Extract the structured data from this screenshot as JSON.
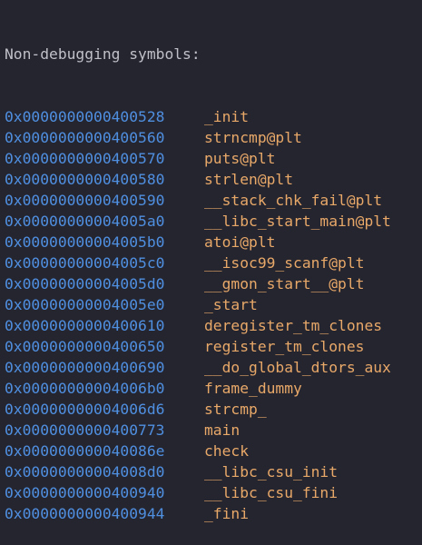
{
  "colors": {
    "background": "#252530",
    "header": "#c0c0c8",
    "address": "#4f8fe0",
    "symbol": "#e8a868"
  },
  "header": "Non-debugging symbols:",
  "symbols": [
    {
      "address": "0x0000000000400528",
      "name": "_init"
    },
    {
      "address": "0x0000000000400560",
      "name": "strncmp@plt"
    },
    {
      "address": "0x0000000000400570",
      "name": "puts@plt"
    },
    {
      "address": "0x0000000000400580",
      "name": "strlen@plt"
    },
    {
      "address": "0x0000000000400590",
      "name": "__stack_chk_fail@plt"
    },
    {
      "address": "0x00000000004005a0",
      "name": "__libc_start_main@plt"
    },
    {
      "address": "0x00000000004005b0",
      "name": "atoi@plt"
    },
    {
      "address": "0x00000000004005c0",
      "name": "__isoc99_scanf@plt"
    },
    {
      "address": "0x00000000004005d0",
      "name": "__gmon_start__@plt"
    },
    {
      "address": "0x00000000004005e0",
      "name": "_start"
    },
    {
      "address": "0x0000000000400610",
      "name": "deregister_tm_clones"
    },
    {
      "address": "0x0000000000400650",
      "name": "register_tm_clones"
    },
    {
      "address": "0x0000000000400690",
      "name": "__do_global_dtors_aux"
    },
    {
      "address": "0x00000000004006b0",
      "name": "frame_dummy"
    },
    {
      "address": "0x00000000004006d6",
      "name": "strcmp_"
    },
    {
      "address": "0x0000000000400773",
      "name": "main"
    },
    {
      "address": "0x000000000040086e",
      "name": "check"
    },
    {
      "address": "0x00000000004008d0",
      "name": "__libc_csu_init"
    },
    {
      "address": "0x0000000000400940",
      "name": "__libc_csu_fini"
    },
    {
      "address": "0x0000000000400944",
      "name": "_fini"
    }
  ]
}
